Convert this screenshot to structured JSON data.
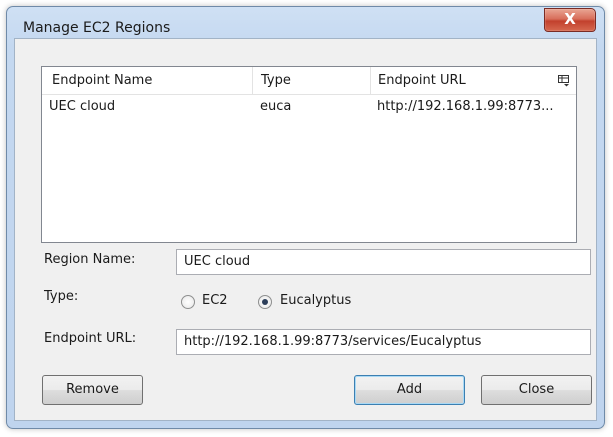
{
  "window": {
    "title": "Manage EC2 Regions",
    "close_symbol": "X"
  },
  "list": {
    "columns": [
      "Endpoint Name",
      "Type",
      "Endpoint URL"
    ],
    "column_chooser_icon": "column-chooser-icon",
    "rows": [
      {
        "name": "UEC cloud",
        "type": "euca",
        "url": "http://192.168.1.99:8773..."
      }
    ]
  },
  "form": {
    "region_name_label": "Region Name:",
    "region_name_value": "UEC cloud",
    "type_label": "Type:",
    "type_options": [
      {
        "label": "EC2",
        "selected": false
      },
      {
        "label": "Eucalyptus",
        "selected": true
      }
    ],
    "endpoint_url_label": "Endpoint URL:",
    "endpoint_url_value": "http://192.168.1.99:8773/services/Eucalyptus"
  },
  "buttons": {
    "remove": "Remove",
    "add": "Add",
    "close": "Close"
  }
}
